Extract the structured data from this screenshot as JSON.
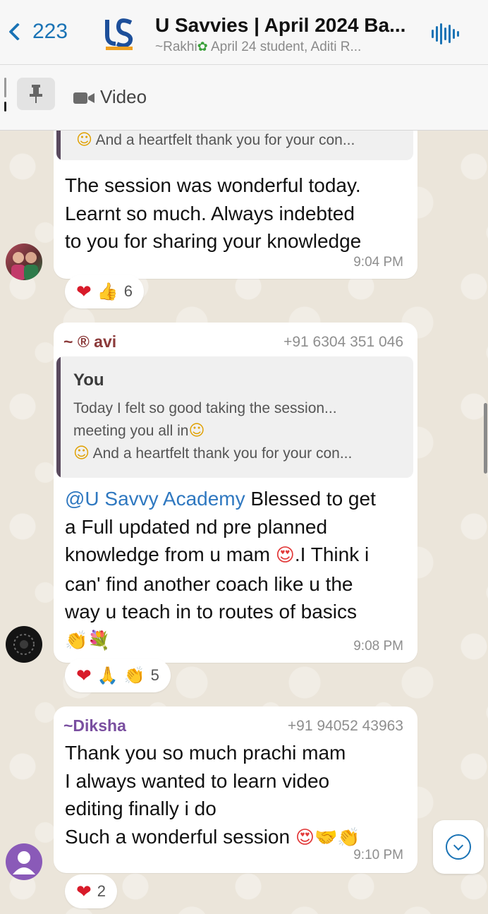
{
  "header": {
    "back_count": "223",
    "title": "U Savvies | April 2024 Ba...",
    "subtitle_prefix": "~Rakhi",
    "subtitle_rest": " April 24 student, Aditi R..."
  },
  "pinned": {
    "label": "Video"
  },
  "messages": [
    {
      "quote_line": "And a heartfelt thank you for your con...",
      "text_lines": [
        "The session was wonderful today.",
        "Learnt so much. Always indebted",
        "to you for sharing your knowledge"
      ],
      "time": "9:04 PM",
      "reactions_count": "6"
    },
    {
      "sender": "~ ® avi",
      "phone": "+91 6304 351 046",
      "quote_name": "You",
      "quote_lines": [
        "Today I felt so good taking the session...",
        "meeting you all in",
        "And a heartfelt thank you for your con..."
      ],
      "mention": "@U Savvy Academy",
      "text_first_rest": " Blessed to get",
      "text_lines": [
        "a  Full updated  nd pre planned",
        "knowledge from u mam",
        ".I Think i",
        "can' find another coach like u the",
        "way u teach  in to routes of basics"
      ],
      "time": "9:08 PM",
      "reactions_count": "5"
    },
    {
      "sender": "~Diksha",
      "phone": "+91 94052 43963",
      "text_lines": [
        "Thank you so much prachi mam",
        "I always wanted to learn video",
        "editing finally i do",
        "Such a wonderful session"
      ],
      "time": "9:10 PM",
      "reactions_count": "2"
    }
  ],
  "colors": {
    "accent": "#1a73b5",
    "sender_avi": "#8b3a3a",
    "sender_diksha": "#7a4fa0",
    "heart": "#d81b2a"
  }
}
